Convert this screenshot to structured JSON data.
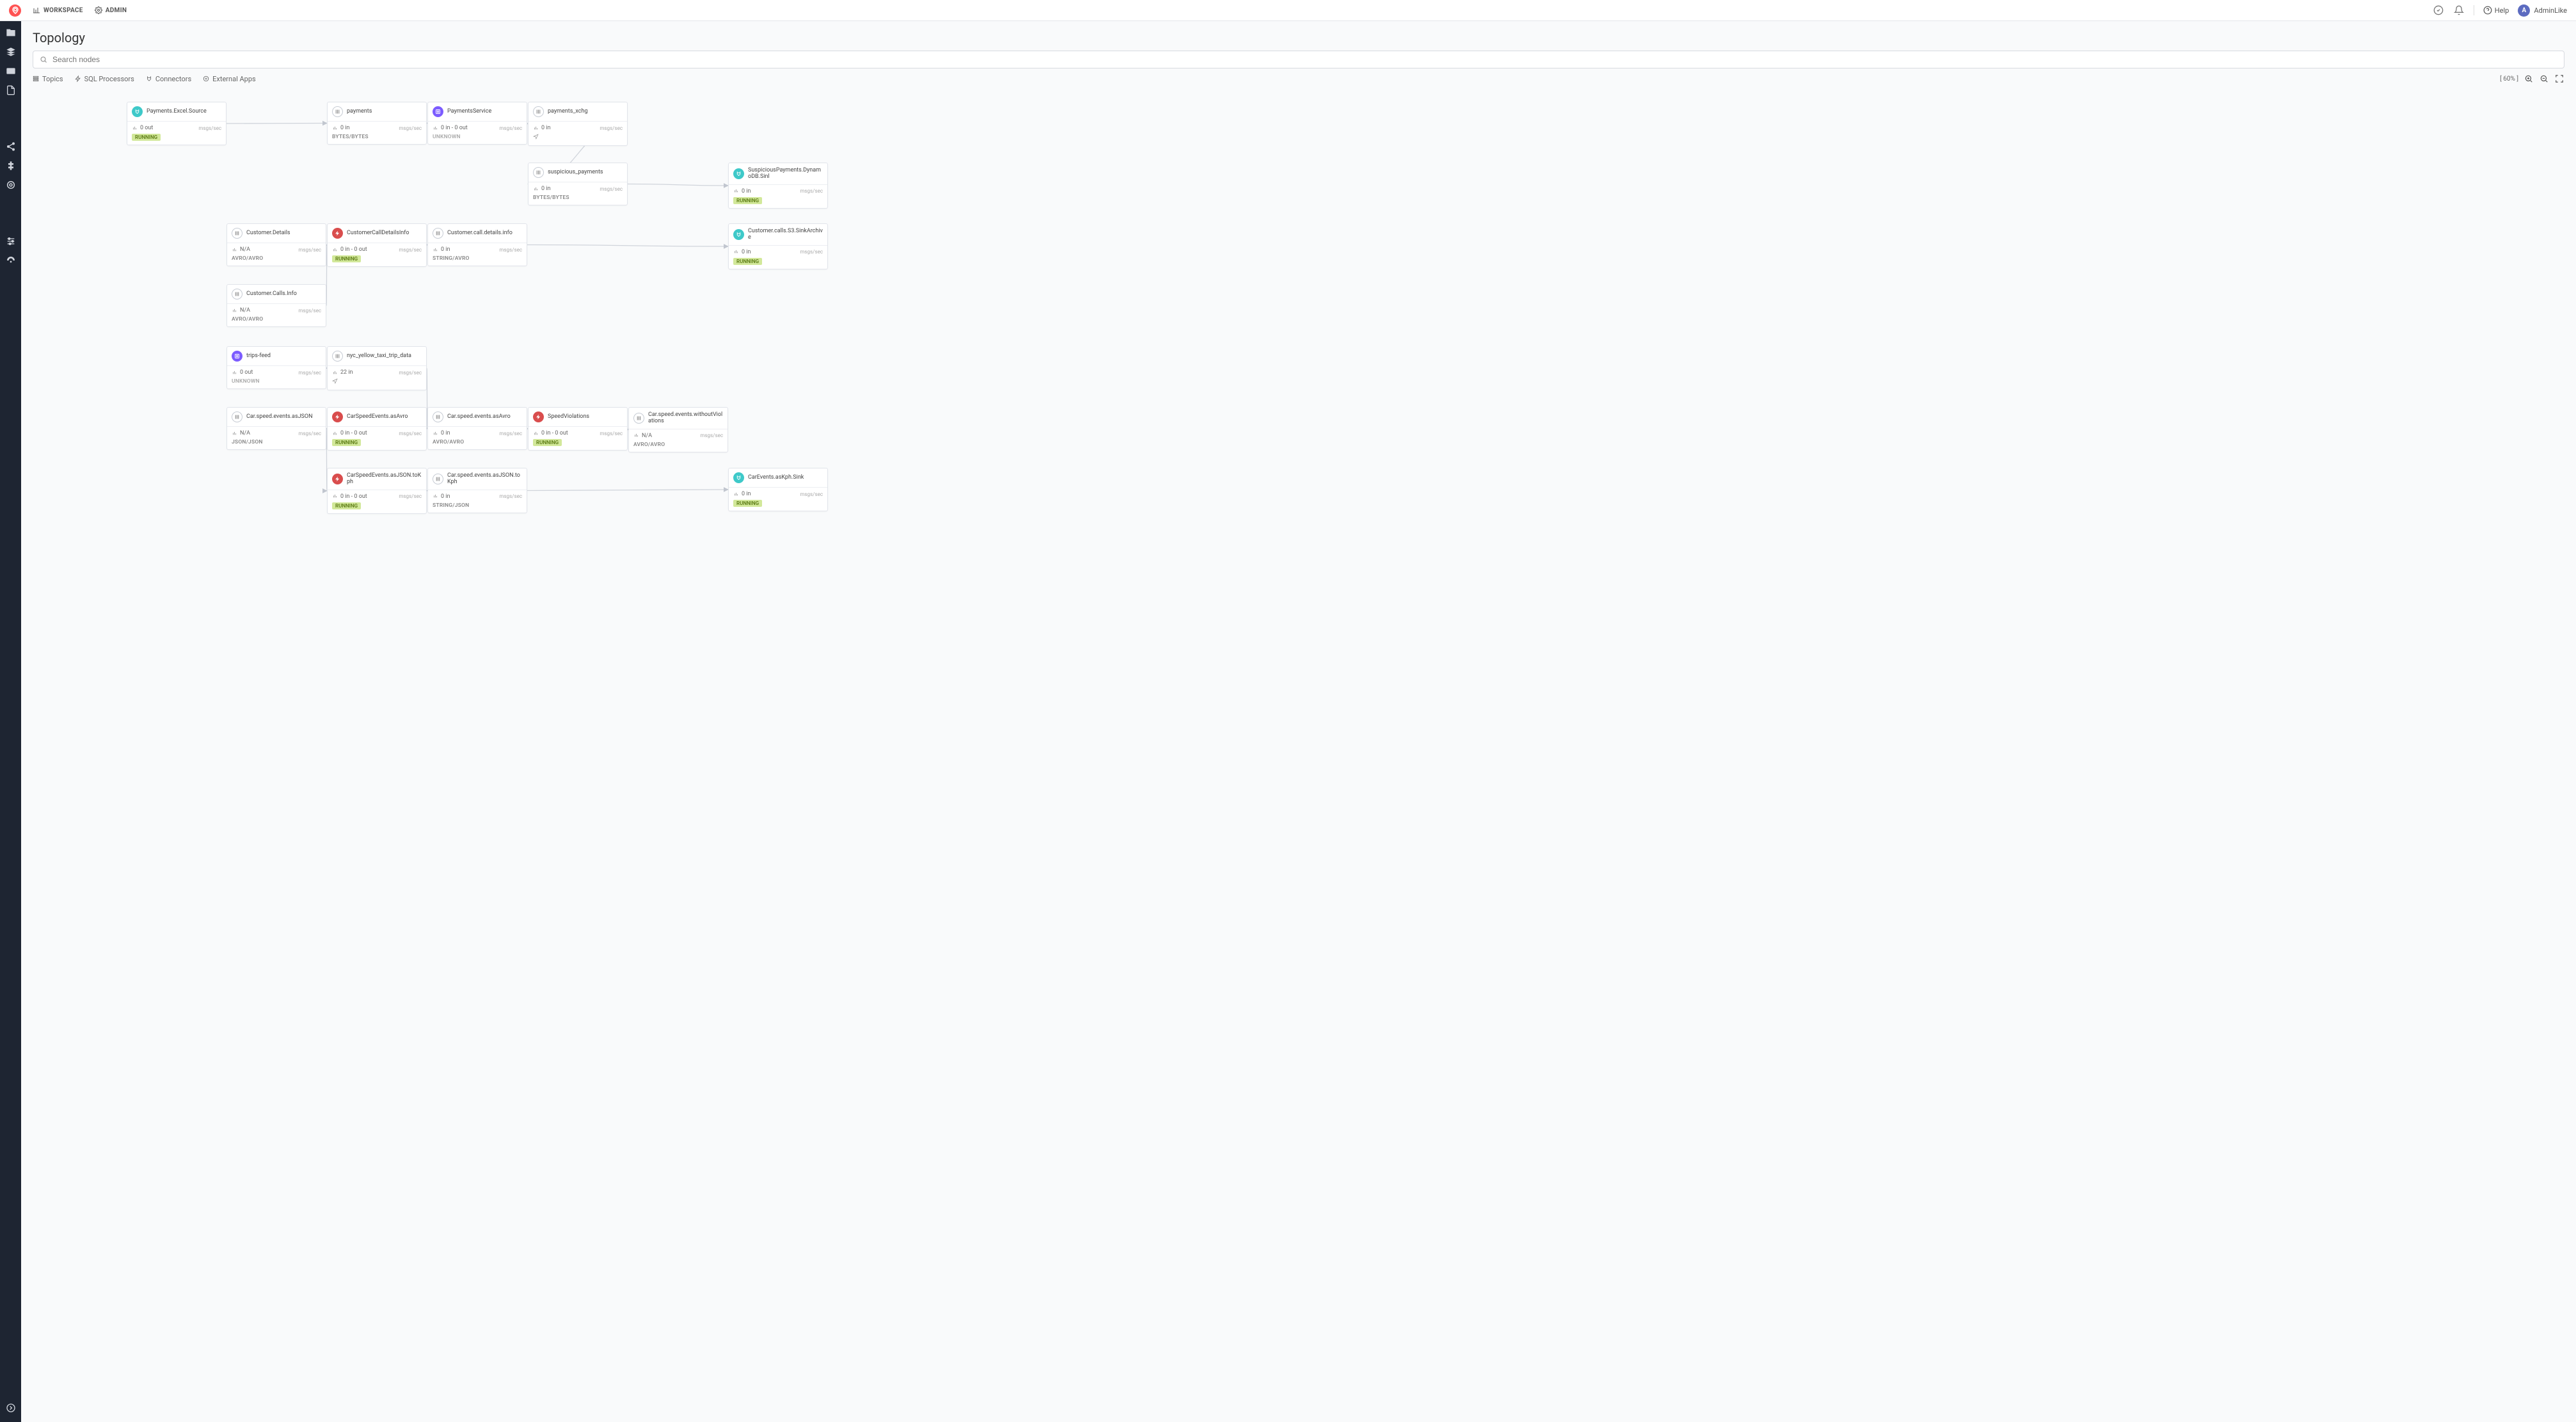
{
  "header": {
    "workspace": "WORKSPACE",
    "admin": "ADMIN",
    "help": "Help",
    "user_initial": "A",
    "user_name": "AdminLike"
  },
  "page": {
    "title": "Topology"
  },
  "search": {
    "placeholder": "Search nodes"
  },
  "filters": {
    "topics": "Topics",
    "sql": "SQL Processors",
    "connectors": "Connectors",
    "apps": "External Apps"
  },
  "zoom": {
    "label": "[ 60% ]"
  },
  "metrics_label": "msgs/sec",
  "status_running": "RUNNING",
  "status_unknown": "UNKNOWN",
  "chart_data": {
    "type": "graph",
    "edges": [
      [
        "n1",
        "n2"
      ],
      [
        "n2",
        "n3"
      ],
      [
        "n3",
        "n4"
      ],
      [
        "n4",
        "n5"
      ],
      [
        "n5",
        "n6"
      ],
      [
        "n7",
        "n8"
      ],
      [
        "n9",
        "n8"
      ],
      [
        "n8",
        "n10"
      ],
      [
        "n10",
        "n11"
      ],
      [
        "n12",
        "n13"
      ],
      [
        "n13",
        "n16"
      ],
      [
        "n14",
        "n15"
      ],
      [
        "n15",
        "n16"
      ],
      [
        "n16",
        "n17"
      ],
      [
        "n17",
        "n18"
      ],
      [
        "n14",
        "n19"
      ],
      [
        "n19",
        "n20"
      ],
      [
        "n20",
        "n21"
      ]
    ]
  },
  "nodes": {
    "n1": {
      "title": "Payments.Excel.Source",
      "kind": "connector",
      "metric": "0 out",
      "footer_type": "badge",
      "footer": "RUNNING"
    },
    "n2": {
      "title": "payments",
      "kind": "stream",
      "metric": "0 in",
      "footer_type": "fmt",
      "footer": "BYTES/BYTES"
    },
    "n3": {
      "title": "PaymentsService",
      "kind": "app",
      "metric": "0 in - 0 out",
      "footer_type": "unknown",
      "footer": "UNKNOWN"
    },
    "n4": {
      "title": "payments_xchg",
      "kind": "stream",
      "metric": "0 in",
      "footer_type": "icon"
    },
    "n5": {
      "title": "suspicious_payments",
      "kind": "stream",
      "metric": "0 in",
      "footer_type": "fmt",
      "footer": "BYTES/BYTES"
    },
    "n6": {
      "title": "SuspiciousPayments.DynamoDB.Sinl",
      "kind": "connector",
      "metric": "0 in",
      "footer_type": "badge",
      "footer": "RUNNING"
    },
    "n7": {
      "title": "Customer.Details",
      "kind": "stream",
      "metric": "N/A",
      "footer_type": "fmt",
      "footer": "AVRO/AVRO"
    },
    "n8": {
      "title": "CustomerCallDetailsInfo",
      "kind": "proc",
      "metric": "0 in - 0 out",
      "footer_type": "badge",
      "footer": "RUNNING"
    },
    "n9": {
      "title": "Customer.Calls.Info",
      "kind": "stream",
      "metric": "N/A",
      "footer_type": "fmt",
      "footer": "AVRO/AVRO"
    },
    "n10": {
      "title": "Customer.call.details.info",
      "kind": "stream",
      "metric": "0 in",
      "footer_type": "fmt",
      "footer": "STRING/AVRO"
    },
    "n11": {
      "title": "Customer.calls.S3.SinkArchive",
      "kind": "connector",
      "metric": "0 in",
      "footer_type": "badge",
      "footer": "RUNNING"
    },
    "n12": {
      "title": "trips-feed",
      "kind": "app",
      "metric": "0 out",
      "footer_type": "unknown",
      "footer": "UNKNOWN"
    },
    "n13": {
      "title": "nyc_yellow_taxi_trip_data",
      "kind": "stream",
      "metric": "22 in",
      "footer_type": "icon"
    },
    "n14": {
      "title": "Car.speed.events.asJSON",
      "kind": "stream",
      "metric": "N/A",
      "footer_type": "fmt",
      "footer": "JSON/JSON"
    },
    "n15": {
      "title": "CarSpeedEvents.asAvro",
      "kind": "proc",
      "metric": "0 in - 0 out",
      "footer_type": "badge",
      "footer": "RUNNING"
    },
    "n16": {
      "title": "Car.speed.events.asAvro",
      "kind": "stream",
      "metric": "0 in",
      "footer_type": "fmt",
      "footer": "AVRO/AVRO"
    },
    "n17": {
      "title": "SpeedViolations",
      "kind": "proc",
      "metric": "0 in - 0 out",
      "footer_type": "badge",
      "footer": "RUNNING"
    },
    "n18": {
      "title": "Car.speed.events.withoutViolations",
      "kind": "stream",
      "metric": "N/A",
      "footer_type": "fmt",
      "footer": "AVRO/AVRO"
    },
    "n19": {
      "title": "CarSpeedEvents.asJSON.toKph",
      "kind": "proc",
      "metric": "0 in - 0 out",
      "footer_type": "badge",
      "footer": "RUNNING"
    },
    "n20": {
      "title": "Car.speed.events.asJSON.toKph",
      "kind": "stream",
      "metric": "0 in",
      "footer_type": "fmt",
      "footer": "STRING/JSON"
    },
    "n21": {
      "title": "CarEvents.asKph.Sink",
      "kind": "connector",
      "metric": "0 in",
      "footer_type": "badge",
      "footer": "RUNNING"
    }
  }
}
